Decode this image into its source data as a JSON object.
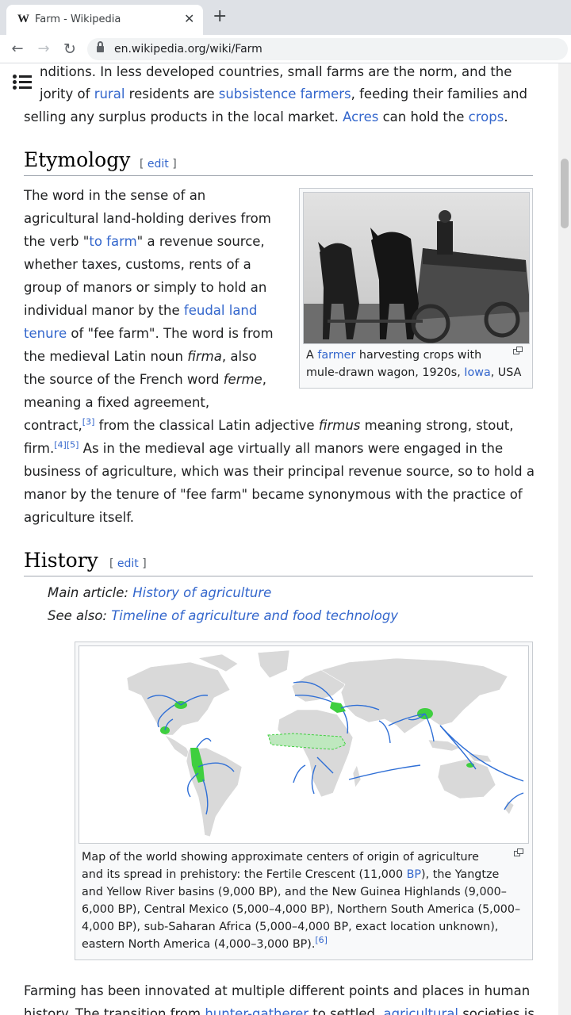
{
  "browser": {
    "tab_title": "Farm - Wikipedia",
    "favicon": "W",
    "tab_close": "✕",
    "new_tab": "+",
    "url": "en.wikipedia.org/wiki/Farm"
  },
  "intro": {
    "line1": "nditions. In less developed countries, small farms are the norm, and the",
    "line2_pre": "jority of ",
    "rural": "rural",
    "line2_mid": " residents are ",
    "subsistence": "subsistence farmers",
    "line2_post": ", feeding their families and",
    "line3_pre": "selling any surplus products in the local market. ",
    "acres": "Acres",
    "line3_mid": " can hold the ",
    "crops": "crops",
    "line3_post": "."
  },
  "etymology": {
    "heading": "Etymology",
    "edit_open": "[ ",
    "edit": "edit",
    "edit_close": " ]",
    "l1": "The word in the sense of an",
    "l2": "agricultural land-holding derives from",
    "l3_pre": "the verb \"",
    "to_farm": "to farm",
    "l3_post": "\" a revenue source,",
    "l4": "whether taxes, customs, rents of a",
    "l5": "group of manors or simply to hold an",
    "l6_pre": "individual manor by the ",
    "feudal_land": "feudal land",
    "tenure": "tenure",
    "l7_post": " of \"fee farm\". The word is from",
    "l8_pre": "the medieval Latin noun ",
    "firma": "firma",
    "l8_post": ", also",
    "l9_pre": "the source of the French word ",
    "ferme": "ferme",
    "l9_post": ",",
    "l10": "meaning a fixed agreement,",
    "l11_pre": "contract,",
    "ref3": "[3]",
    "l11_mid": " from the classical Latin adjective ",
    "firmus": "firmus",
    "l11_post": " meaning strong, stout,",
    "l12_pre": "firm.",
    "ref4": "[4]",
    "ref5": "[5]",
    "l12_post": " As in the medieval age virtually all manors were engaged in the",
    "l13": "business of agriculture, which was their principal revenue source, so to hold a",
    "l14": "manor by the tenure of \"fee farm\" became synonymous with the practice of",
    "l15": "agriculture itself.",
    "figure": {
      "cap1_pre": "A ",
      "farmer": "farmer",
      "cap1_post": " harvesting crops with",
      "cap2_pre": "mule-drawn wagon, 1920s, ",
      "iowa": "Iowa",
      "cap2_post": ", USA"
    }
  },
  "history": {
    "heading": "History",
    "edit_open": "[ ",
    "edit": "edit",
    "edit_close": " ]",
    "main_label": "Main article: ",
    "main_link": "History of agriculture",
    "see_label": "See also: ",
    "see_link": "Timeline of agriculture and food technology",
    "map_caption": {
      "c1": "Map of the world showing approximate centers of origin of agriculture",
      "c2_pre": "and its spread in prehistory: the Fertile Crescent (11,000 ",
      "bp": "BP",
      "c2_post": "), the Yangtze",
      "c3": "and Yellow River basins (9,000 BP), and the New Guinea Highlands (9,000–",
      "c4": "6,000 BP), Central Mexico (5,000–4,000 BP), Northern South America (5,000–",
      "c5": "4,000 BP), sub-Saharan Africa (5,000–4,000 BP, exact location unknown),",
      "c6": "eastern North America (4,000–3,000 BP).",
      "ref6": "[6]"
    },
    "p1": "Farming has been innovated at multiple different points and places in human",
    "p2_pre": "history. The transition from ",
    "hunter": "hunter-gatherer",
    "p2_mid": " to settled, ",
    "agricultural": "agricultural",
    "p2_post": " societies is"
  },
  "colors": {
    "link": "#3366cc",
    "text": "#202122",
    "origin_centers": "#3fcf3f",
    "spread_arrows": "#2f6fd6",
    "land": "#d9d9d9"
  }
}
